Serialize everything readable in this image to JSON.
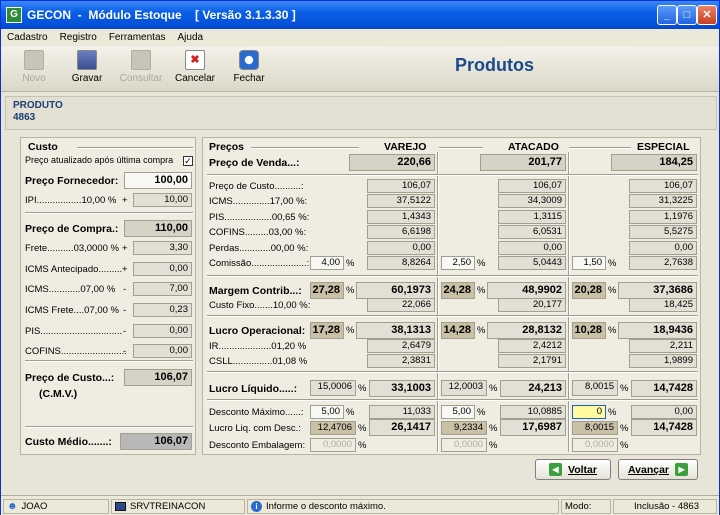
{
  "window": {
    "title": "GECON  -  Módulo Estoque    [ Versão 3.1.3.30 ]",
    "icon": "G"
  },
  "menu": [
    "Cadastro",
    "Registro",
    "Ferramentas",
    "Ajuda"
  ],
  "toolbar": {
    "novo": "Novo",
    "gravar": "Gravar",
    "consultar": "Consultar",
    "cancelar": "Cancelar",
    "fechar": "Fechar"
  },
  "page_title": "Produtos",
  "product": {
    "label": "PRODUTO",
    "code": "4863"
  },
  "custo": {
    "title": "Custo",
    "preco_atualizado": "Preço atualizado após última compra",
    "preco_fornecedor_label": "Preço Fornecedor:",
    "preco_fornecedor": "100,00",
    "ipi_label": "IPI.................10,00 %",
    "ipi_sign": "+",
    "ipi": "10,00",
    "preco_compra_label": "Preço de Compra.:",
    "preco_compra": "110,00",
    "frete_label": "Frete..........03,0000 %",
    "frete_sign": "+",
    "frete": "3,30",
    "icms_ant_label": "ICMS Antecipado.........",
    "icms_ant_sign": "+",
    "icms_ant": "0,00",
    "icms_label": "ICMS............07,00 %",
    "icms_sign": "-",
    "icms": "7,00",
    "icms_frete_label": "ICMS Frete....07,00 %",
    "icms_frete_sign": "-",
    "icms_frete": "0,23",
    "pis_label": "PIS...............................",
    "pis_sign": "-",
    "pis": "0,00",
    "cofins_label": "COFINS.........................",
    "cofins_sign": "-",
    "cofins": "0,00",
    "preco_custo_label": "Preço de Custo...:",
    "preco_custo_sub": "(C.M.V.)",
    "preco_custo": "106,07",
    "custo_medio_label": "Custo Médio.......:",
    "custo_medio": "106,07"
  },
  "precos": {
    "title": "Preços",
    "cols": [
      "VAREJO",
      "ATACADO",
      "ESPECIAL"
    ],
    "preco_venda_label": "Preço de Venda...:",
    "preco_venda": [
      "220,66",
      "201,77",
      "184,25"
    ],
    "preco_custo_label": "Preço de Custo..........:",
    "preco_custo": [
      "106,07",
      "106,07",
      "106,07"
    ],
    "icms_label": "ICMS..............17,00 %:",
    "icms": [
      "37,5122",
      "34,3009",
      "31,3225"
    ],
    "pis_label": "PIS..................00,65 %:",
    "pis": [
      "1,4343",
      "1,3115",
      "1,1976"
    ],
    "cofins_label": "COFINS.........03,00 %:",
    "cofins": [
      "6,6198",
      "6,0531",
      "5,5275"
    ],
    "perdas_label": "Perdas............00,00 %:",
    "perdas": [
      "0,00",
      "0,00",
      "0,00"
    ],
    "comissao_label": "Comissão.....................:",
    "comissao_pct": [
      "4,00",
      "2,50",
      "1,50"
    ],
    "comissao": [
      "8,8264",
      "5,0443",
      "2,7638"
    ],
    "margem_label": "Margem Contrib...:",
    "margem_pct": [
      "27,28",
      "24,28",
      "20,28"
    ],
    "margem": [
      "60,1973",
      "48,9902",
      "37,3686"
    ],
    "custo_fixo_label": "Custo Fixo.......10,00 %:",
    "custo_fixo": [
      "22,066",
      "20,177",
      "18,425"
    ],
    "lucro_op_label": "Lucro Operacional:",
    "lucro_op_pct": [
      "17,28",
      "14,28",
      "10,28"
    ],
    "lucro_op": [
      "38,1313",
      "28,8132",
      "18,9436"
    ],
    "ir_label": "IR....................01,20 %",
    "ir": [
      "2,6479",
      "2,4212",
      "2,211"
    ],
    "csll_label": "CSLL...............01,08 %",
    "csll": [
      "2,3831",
      "2,1791",
      "1,9899"
    ],
    "lucro_liq_label": "Lucro Líquido.....:",
    "lucro_liq_pct": [
      "15,0006",
      "12,0003",
      "8,0015"
    ],
    "lucro_liq": [
      "33,1003",
      "24,213",
      "14,7428"
    ],
    "desc_max_label": "Desconto Máximo......:",
    "desc_max_pct": [
      "5,00",
      "5,00",
      "0"
    ],
    "desc_max": [
      "11,033",
      "10,0885",
      "0,00"
    ],
    "lucro_desc_label": "Lucro Liq. com Desc.:",
    "lucro_desc_pct": [
      "12,4706",
      "9,2334",
      "8,0015"
    ],
    "lucro_desc": [
      "26,1417",
      "17,6987",
      "14,7428"
    ],
    "desc_emb_label": "Desconto Embalagem:",
    "desc_emb": [
      "0,0000",
      "0,0000",
      "0,0000"
    ],
    "pct_symbol": "%"
  },
  "buttons": {
    "voltar": "Voltar",
    "avancar": "Avançar"
  },
  "statusbar": {
    "user": "JOAO",
    "server": "SRVTREINACON",
    "message": "Informe o desconto máximo.",
    "mode_label": "Modo:",
    "mode": "Inclusão - 4863"
  }
}
